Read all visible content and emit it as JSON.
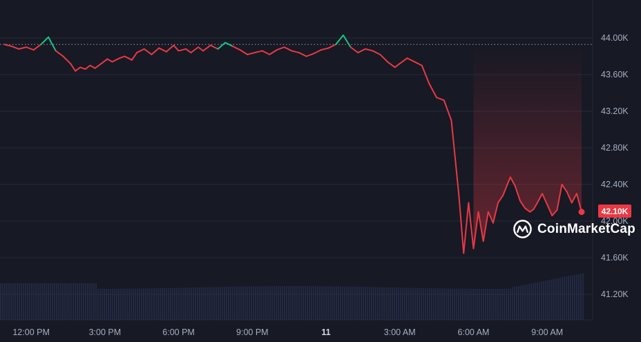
{
  "chart_data": {
    "type": "line",
    "title": "",
    "xlabel": "",
    "ylabel": "",
    "ylim": [
      41.0,
      44.15
    ],
    "y_unit": "K",
    "y_ticks": [
      "44.00K",
      "43.60K",
      "43.20K",
      "42.80K",
      "42.40K",
      "42.00K",
      "41.60K",
      "41.20K"
    ],
    "y_tick_values": [
      44.0,
      43.6,
      43.2,
      42.8,
      42.4,
      42.0,
      41.6,
      41.2
    ],
    "x_ticks": [
      "12:00 PM",
      "3:00 PM",
      "6:00 PM",
      "9:00 PM",
      "11",
      "3:00 AM",
      "6:00 AM",
      "9:00 AM"
    ],
    "x_tick_values": [
      12,
      15,
      18,
      21,
      24,
      27,
      30,
      33
    ],
    "x_unit": "hours since midnight of day 10 (tick label '11' = midnight)",
    "reference_line": 43.93,
    "current_price_label": "42.10K",
    "colors": {
      "up": "#16c784",
      "down": "#ea3943",
      "grid": "#262a38",
      "volume": "#2a3150"
    },
    "grid": true,
    "series": [
      {
        "x": [
          10.9,
          11.2,
          11.5,
          11.8,
          12.1,
          12.4,
          12.7,
          13.0,
          13.3,
          13.6,
          13.8,
          14.0,
          14.2,
          14.4,
          14.6,
          14.9,
          15.1,
          15.3,
          15.6,
          15.8,
          16.1,
          16.3,
          16.6,
          16.9,
          17.2,
          17.5,
          17.8,
          18.0,
          18.3,
          18.5,
          18.8,
          19.0,
          19.3,
          19.6,
          19.9,
          20.2,
          20.5,
          20.8,
          21.1,
          21.4,
          21.7,
          22.0,
          22.3,
          22.6,
          22.9,
          23.2,
          23.5,
          23.8,
          24.1,
          24.4,
          24.7,
          25.0,
          25.3,
          25.6,
          25.9,
          26.2,
          26.5,
          26.8,
          27.0,
          27.3,
          27.6,
          27.9,
          28.2,
          28.5,
          28.8,
          29.1,
          29.4,
          29.6,
          29.8,
          30.0,
          30.2,
          30.4,
          30.6,
          30.8,
          31.0,
          31.2,
          31.5,
          31.7,
          31.9,
          32.0,
          32.1,
          32.2,
          32.3,
          32.45,
          32.6,
          32.8,
          33.0,
          33.2,
          33.4,
          33.6,
          33.8,
          34.0,
          34.2,
          34.4
        ],
        "y": [
          43.93,
          43.91,
          43.88,
          43.9,
          43.87,
          43.93,
          44.01,
          43.86,
          43.8,
          43.72,
          43.64,
          43.68,
          43.66,
          43.7,
          43.67,
          43.73,
          43.77,
          43.74,
          43.78,
          43.8,
          43.76,
          43.84,
          43.88,
          43.82,
          43.89,
          43.85,
          43.92,
          43.86,
          43.88,
          43.84,
          43.9,
          43.86,
          43.92,
          43.88,
          43.95,
          43.91,
          43.87,
          43.82,
          43.84,
          43.86,
          43.82,
          43.87,
          43.9,
          43.86,
          43.84,
          43.8,
          43.83,
          43.87,
          43.89,
          43.93,
          44.03,
          43.9,
          43.84,
          43.88,
          43.86,
          43.82,
          43.74,
          43.68,
          43.72,
          43.78,
          43.74,
          43.7,
          43.5,
          43.35,
          43.32,
          43.1,
          42.3,
          41.65,
          42.2,
          41.7,
          42.1,
          41.78,
          42.1,
          41.98,
          42.2,
          42.28,
          42.48,
          42.38,
          42.22,
          42.18,
          42.14,
          42.12,
          42.1,
          42.13,
          42.2,
          42.3,
          42.18,
          42.06,
          42.12,
          42.4,
          42.32,
          42.2,
          42.3,
          42.1
        ],
        "color": "#ea3943"
      }
    ]
  }
}
